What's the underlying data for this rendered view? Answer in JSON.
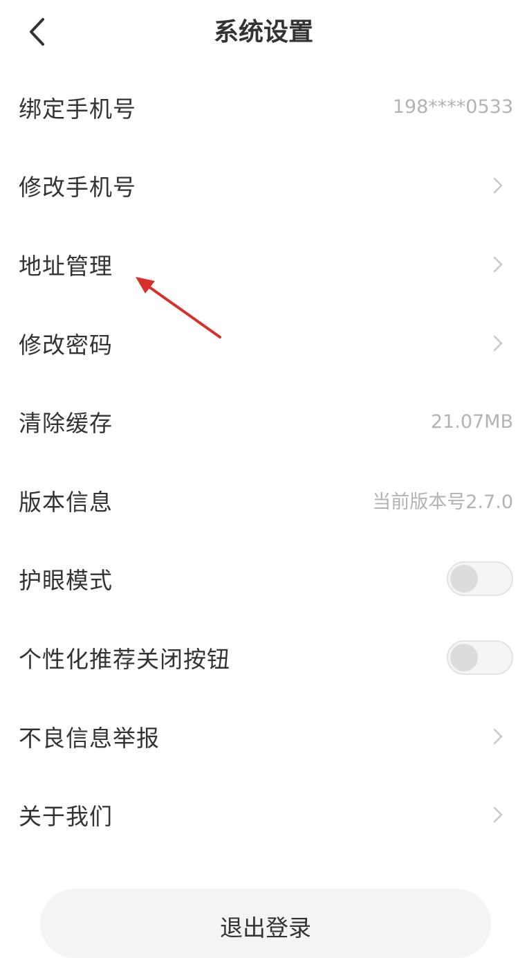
{
  "header": {
    "title": "系统设置",
    "back_icon": "chevron-left-icon"
  },
  "rows": [
    {
      "label": "绑定手机号",
      "value": "198****0533",
      "control": "value"
    },
    {
      "label": "修改手机号",
      "control": "chevron"
    },
    {
      "label": "地址管理",
      "control": "chevron"
    },
    {
      "label": "修改密码",
      "control": "chevron"
    },
    {
      "label": "清除缓存",
      "value": "21.07MB",
      "control": "value"
    },
    {
      "label": "版本信息",
      "value": "当前版本号2.7.0",
      "control": "value"
    },
    {
      "label": "护眼模式",
      "control": "toggle",
      "on": false
    },
    {
      "label": "个性化推荐关闭按钮",
      "control": "toggle",
      "on": false
    },
    {
      "label": "不良信息举报",
      "control": "chevron"
    },
    {
      "label": "关于我们",
      "control": "chevron"
    }
  ],
  "logout_label": "退出登录",
  "colors": {
    "annotation_arrow": "#d9302b",
    "secondary_text": "#b3b3b3",
    "primary_text": "#333333"
  }
}
